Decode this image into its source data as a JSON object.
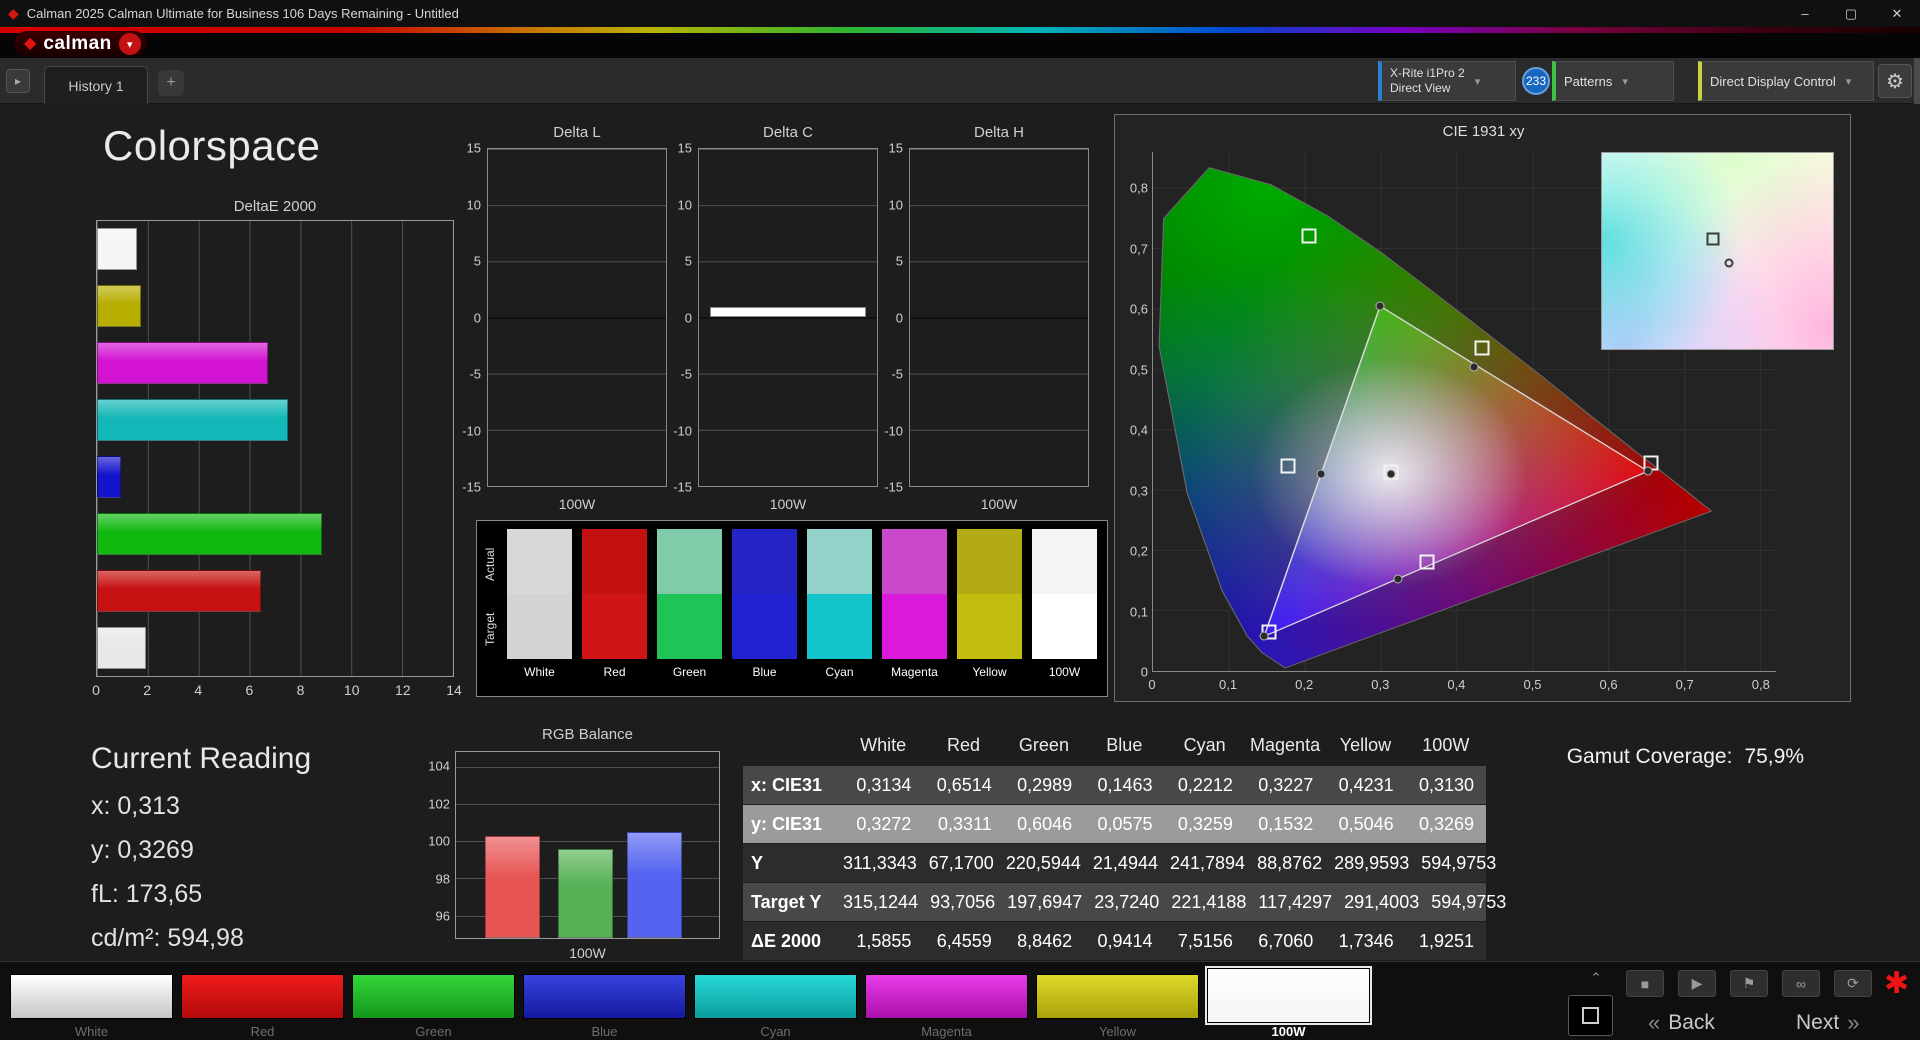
{
  "window": {
    "title": "Calman 2025 Calman Ultimate for Business 106 Days Remaining  - Untitled"
  },
  "icons": {
    "app_diamond": "◆",
    "logo_diamond": "◆",
    "logo_dropdown": "▾",
    "tab_nav": "▸",
    "dropdown_chevron": "▾",
    "gear": "⚙",
    "minimize": "–",
    "maximize": "▢",
    "close": "✕",
    "chevron_up": "⌃",
    "stop": "■",
    "play": "▶",
    "flag": "⚑",
    "link": "∞",
    "refresh": "⟳",
    "asterisk": "✱",
    "back_chevrons": "«",
    "next_chevrons": "»"
  },
  "brand": {
    "name": "calman"
  },
  "tabbar": {
    "tab": "History 1",
    "add": "+",
    "meter_line1": "X-Rite i1Pro 2",
    "meter_line2": "Direct View",
    "badge": "233",
    "patterns": "Patterns",
    "display_control": "Direct Display Control",
    "accents": {
      "meter": "#2f7fd0",
      "patterns": "#43c04b",
      "display_control": "#c9d23e"
    }
  },
  "page": {
    "title": "Colorspace"
  },
  "chart_data": [
    {
      "type": "bar",
      "title": "DeltaE 2000",
      "categories": [
        "White",
        "Yellow",
        "Magenta",
        "Cyan",
        "Blue",
        "Green",
        "Red",
        "100W"
      ],
      "values": [
        1.5855,
        1.7346,
        6.706,
        7.5156,
        0.9414,
        8.8462,
        6.4559,
        1.9251
      ],
      "colors": [
        "#f5f5f5",
        "#b7ae00",
        "#d214d2",
        "#14b7b7",
        "#1414cc",
        "#10b910",
        "#c61212",
        "#e8e8e8"
      ],
      "x_ticks": [
        "0",
        "2",
        "4",
        "6",
        "8",
        "10",
        "12",
        "14"
      ],
      "x_max": 14
    },
    {
      "type": "bar",
      "title": "RGB Balance",
      "categories": [
        "Red",
        "Green",
        "Blue"
      ],
      "values": [
        100.3,
        99.6,
        100.5
      ],
      "colors": [
        "#e85555",
        "#57b257",
        "#5463f0"
      ],
      "y_ticks": [
        104,
        102,
        100,
        98,
        96
      ],
      "x_label": "100W",
      "ylim": [
        94.8,
        104.8
      ]
    }
  ],
  "delta_charts": {
    "y_ticks": [
      "15",
      "10",
      "5",
      "0",
      "-5",
      "-10",
      "-15"
    ],
    "y_range": 15,
    "items": [
      {
        "title": "Delta L",
        "value": 0.0,
        "x_label": "100W"
      },
      {
        "title": "Delta C",
        "value": 0.9,
        "x_label": "100W"
      },
      {
        "title": "Delta H",
        "value": 0.0,
        "x_label": "100W"
      }
    ]
  },
  "swatch_strip": {
    "row_labels": [
      "Actual",
      "Target"
    ],
    "columns": [
      {
        "label": "White",
        "actual": "#d8d8d8",
        "target": "#d3d3d3"
      },
      {
        "label": "Red",
        "actual": "#c31010",
        "target": "#cf1515"
      },
      {
        "label": "Green",
        "actual": "#7fcbaa",
        "target": "#1ec455"
      },
      {
        "label": "Blue",
        "actual": "#2525c6",
        "target": "#2121d2"
      },
      {
        "label": "Cyan",
        "actual": "#93d2cb",
        "target": "#12c3cb"
      },
      {
        "label": "Magenta",
        "actual": "#ca49ca",
        "target": "#da19da"
      },
      {
        "label": "Yellow",
        "actual": "#b2ab14",
        "target": "#c3bc11"
      },
      {
        "label": "100W",
        "actual": "#f4f4f4",
        "target": "#ffffff"
      }
    ]
  },
  "cie": {
    "title": "CIE 1931 xy",
    "gamut_label": "Gamut Coverage:",
    "gamut_value": "75,9%",
    "x_ticks": [
      "0",
      "0,1",
      "0,2",
      "0,3",
      "0,4",
      "0,5",
      "0,6",
      "0,7",
      "0,8"
    ],
    "y_ticks": [
      "0,8",
      "0,7",
      "0,6",
      "0,5",
      "0,4",
      "0,3",
      "0,2",
      "0,1",
      "0"
    ],
    "measured": {
      "red": [
        0.6514,
        0.3311
      ],
      "green": [
        0.2989,
        0.6046
      ],
      "blue": [
        0.1463,
        0.0575
      ],
      "cyan": [
        0.2212,
        0.3259
      ],
      "magenta": [
        0.3227,
        0.1532
      ],
      "yellow": [
        0.4231,
        0.5046
      ],
      "white": [
        0.3134,
        0.3272
      ]
    },
    "targets": {
      "red": [
        0.655,
        0.345
      ],
      "green": [
        0.205,
        0.72
      ],
      "blue": [
        0.152,
        0.065
      ],
      "cyan": [
        0.178,
        0.34
      ],
      "magenta": [
        0.361,
        0.18
      ],
      "yellow": [
        0.433,
        0.536
      ],
      "white": [
        0.3127,
        0.329
      ]
    }
  },
  "current_reading": {
    "title": "Current Reading",
    "lines": [
      {
        "label": "x:",
        "value": "0,313"
      },
      {
        "label": "y:",
        "value": "0,3269"
      },
      {
        "label": "fL:",
        "value": "173,65"
      },
      {
        "label": "cd/m²:",
        "value": "594,98"
      }
    ]
  },
  "table": {
    "columns": [
      "White",
      "Red",
      "Green",
      "Blue",
      "Cyan",
      "Magenta",
      "Yellow",
      "100W"
    ],
    "rows": [
      {
        "label": "x: CIE31",
        "shade": "mid",
        "values": [
          "0,3134",
          "0,6514",
          "0,2989",
          "0,1463",
          "0,2212",
          "0,3227",
          "0,4231",
          "0,3130"
        ]
      },
      {
        "label": "y: CIE31",
        "shade": "light",
        "values": [
          "0,3272",
          "0,3311",
          "0,6046",
          "0,0575",
          "0,3259",
          "0,1532",
          "0,5046",
          "0,3269"
        ]
      },
      {
        "label": "Y",
        "shade": "dark",
        "values": [
          "311,3343",
          "67,1700",
          "220,5944",
          "21,4944",
          "241,7894",
          "88,8762",
          "289,9593",
          "594,9753"
        ]
      },
      {
        "label": "Target Y",
        "shade": "mid",
        "values": [
          "315,1244",
          "93,7056",
          "197,6947",
          "23,7240",
          "221,4188",
          "117,4297",
          "291,4003",
          "594,9753"
        ]
      },
      {
        "label": "ΔE 2000",
        "shade": "dark",
        "values": [
          "1,5855",
          "6,4559",
          "8,8462",
          "0,9414",
          "7,5156",
          "6,7060",
          "1,7346",
          "1,9251"
        ]
      }
    ]
  },
  "bottom_bar": {
    "swatches": [
      {
        "label": "White",
        "top": "#ffffff",
        "bottom": "#c6c6c6",
        "selected": false
      },
      {
        "label": "Red",
        "top": "#f01a1a",
        "bottom": "#b20b0b",
        "selected": false
      },
      {
        "label": "Green",
        "top": "#33d73a",
        "bottom": "#14961a",
        "selected": false
      },
      {
        "label": "Blue",
        "top": "#3842e0",
        "bottom": "#141a9e",
        "selected": false
      },
      {
        "label": "Cyan",
        "top": "#27d8d8",
        "bottom": "#0c9c9c",
        "selected": false
      },
      {
        "label": "Magenta",
        "top": "#e93ce9",
        "bottom": "#ab10ab",
        "selected": false
      },
      {
        "label": "Yellow",
        "top": "#e0d92a",
        "bottom": "#a9a20c",
        "selected": false
      },
      {
        "label": "100W",
        "top": "#ffffff",
        "bottom": "#f4f4f4",
        "selected": true
      }
    ],
    "back": "Back",
    "next": "Next"
  }
}
